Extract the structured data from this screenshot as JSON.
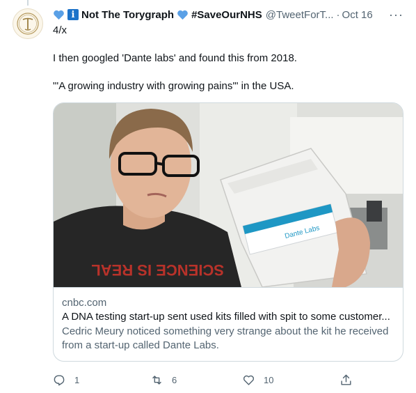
{
  "tweet": {
    "author_name": "Not The Torygraph",
    "author_tag": "#SaveOurNHS",
    "handle": "@TweetForT...",
    "separator": "·",
    "date": "Oct 16",
    "more_icon": "more-horizontal-icon",
    "lines": [
      "4/x",
      "I then googled 'Dante labs' and found this from 2018.",
      "\"'A growing industry with growing pains'\" in the USA."
    ]
  },
  "card": {
    "domain": "cnbc.com",
    "title": "A DNA testing start-up sent used kits filled with spit to some customer...",
    "description": "Cedric Meury noticed something very strange about the kit he received from a start-up called Dante Labs.",
    "image_kit_text": "Dante Labs",
    "image_shirt_text": "SCIENCE IS REAL"
  },
  "actions": {
    "reply_count": "1",
    "retweet_count": "6",
    "like_count": "10"
  },
  "colors": {
    "heart_blue": "#5aa0e6",
    "badge_blue": "#1d73c9",
    "secondary_text": "#536471",
    "border": "#cfd9de",
    "kit_accent": "#1e97c4"
  }
}
